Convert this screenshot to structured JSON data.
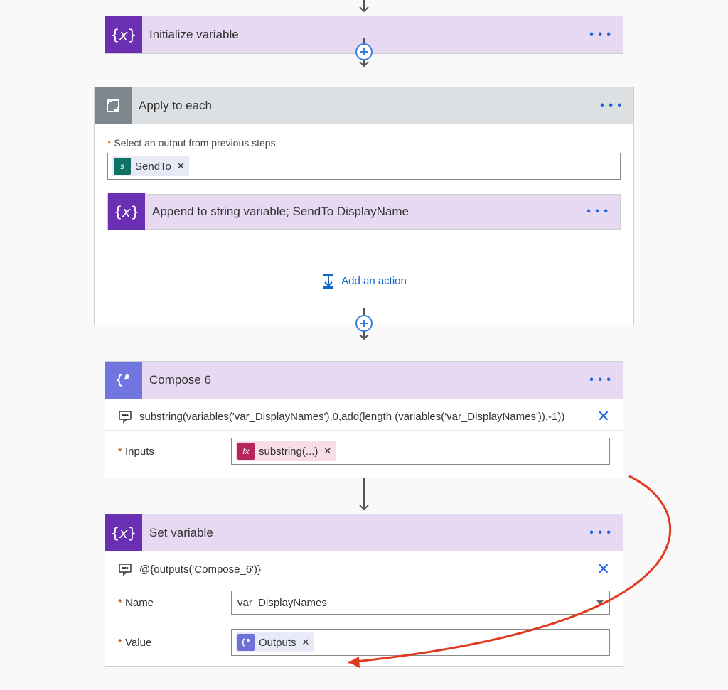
{
  "steps": {
    "init_var": {
      "title": "Initialize variable"
    },
    "apply_each": {
      "title": "Apply to each",
      "select_label": "Select an output from previous steps",
      "token_sendto": "SendTo",
      "append": {
        "title": "Append to string variable; SendTo DisplayName"
      },
      "add_action": "Add an action"
    },
    "compose6": {
      "title": "Compose 6",
      "peek": "substring(variables('var_DisplayNames'),0,add(length (variables('var_DisplayNames')),-1))",
      "inputs_label": "Inputs",
      "token_sub": "substring(...)"
    },
    "set_var": {
      "title": "Set variable",
      "peek": "@{outputs('Compose_6')}",
      "name_label": "Name",
      "name_value": "var_DisplayNames",
      "value_label": "Value",
      "token_outputs": "Outputs"
    }
  }
}
